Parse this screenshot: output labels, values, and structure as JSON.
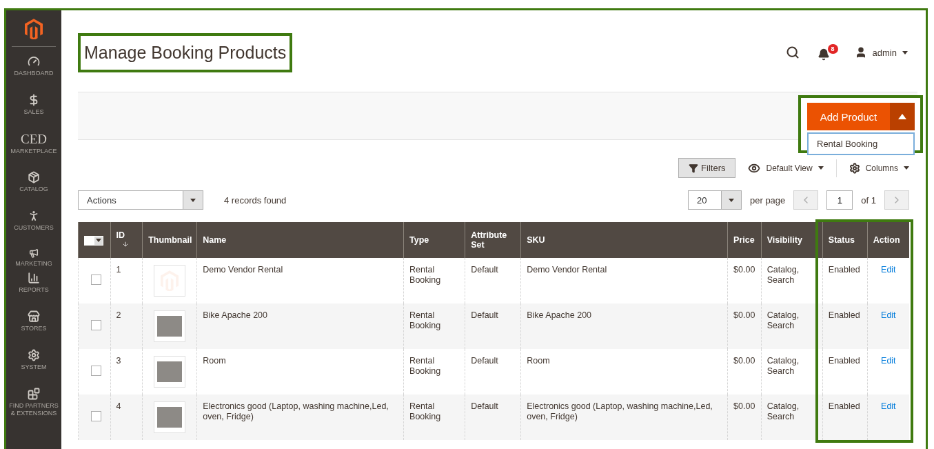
{
  "sidebar": {
    "items": [
      {
        "kind": "icon",
        "label": "DASHBOARD"
      },
      {
        "kind": "icon",
        "label": "SALES"
      },
      {
        "kind": "wordmark",
        "mark": "CED",
        "label": "MARKETPLACE"
      },
      {
        "kind": "icon",
        "label": "CATALOG"
      },
      {
        "kind": "icon",
        "label": "CUSTOMERS"
      },
      {
        "kind": "icon",
        "label": "MARKETING"
      },
      {
        "kind": "icon",
        "label": "REPORTS"
      },
      {
        "kind": "icon",
        "label": "STORES"
      },
      {
        "kind": "icon",
        "label": "SYSTEM"
      },
      {
        "kind": "icon",
        "label": "FIND PARTNERS & EXTENSIONS"
      }
    ]
  },
  "header": {
    "title": "Manage Booking Products",
    "notifications": "8",
    "user": "admin"
  },
  "add_product": {
    "label": "Add Product",
    "expanded": true,
    "menu": [
      "Rental Booking"
    ]
  },
  "toolbar": {
    "filters": "Filters",
    "view": "Default View",
    "columns": "Columns"
  },
  "actions": {
    "value": "Actions",
    "records": "4 records found",
    "page_size": "20",
    "per_page": "per page",
    "page": "1",
    "of": "of 1"
  },
  "table": {
    "columns": [
      "ID",
      "Thumbnail",
      "Name",
      "Type",
      "Attribute Set",
      "SKU",
      "Price",
      "Visibility",
      "Status",
      "Action"
    ],
    "rows": [
      {
        "checked": false,
        "id": "1",
        "kind": "logo",
        "name": "Demo Vendor Rental",
        "type": "Rental Booking",
        "attribute_set": "Default",
        "sku": "Demo Vendor Rental",
        "price": "$0.00",
        "visibility": "Catalog, Search",
        "status": "Enabled",
        "action": "Edit"
      },
      {
        "checked": false,
        "id": "2",
        "kind": "photo",
        "name": "Bike Apache 200",
        "type": "Rental Booking",
        "attribute_set": "Default",
        "sku": "Bike Apache 200",
        "price": "$0.00",
        "visibility": "Catalog, Search",
        "status": "Enabled",
        "action": "Edit"
      },
      {
        "checked": false,
        "id": "3",
        "kind": "photo",
        "name": "Room",
        "type": "Rental Booking",
        "attribute_set": "Default",
        "sku": "Room",
        "price": "$0.00",
        "visibility": "Catalog, Search",
        "status": "Enabled",
        "action": "Edit"
      },
      {
        "checked": false,
        "id": "4",
        "kind": "photo",
        "name": "Electronics good (Laptop, washing machine,Led, oven, Fridge)",
        "type": "Rental Booking",
        "attribute_set": "Default",
        "sku": "Electronics good (Laptop, washing machine,Led, oven, Fridge)",
        "price": "$0.00",
        "visibility": "Catalog, Search",
        "status": "Enabled",
        "action": "Edit"
      }
    ]
  }
}
